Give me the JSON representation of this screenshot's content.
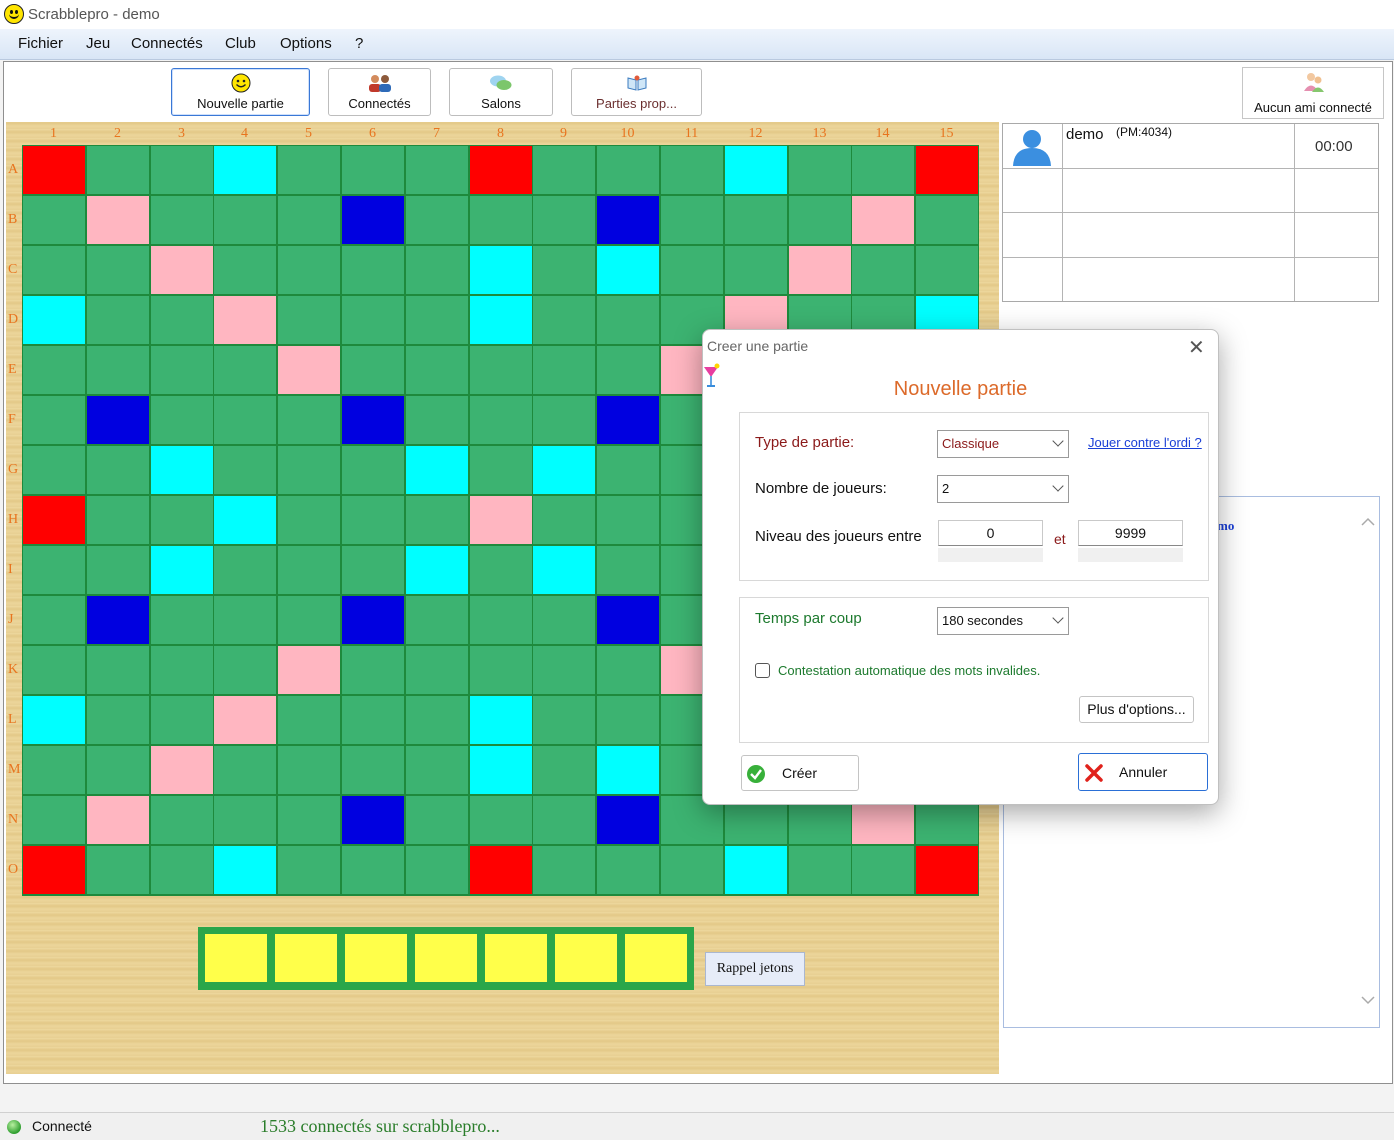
{
  "window": {
    "title": "Scrabblepro - demo"
  },
  "menu": [
    "Fichier",
    "Jeu",
    "Connectés",
    "Club",
    "Options",
    "?"
  ],
  "toolbar": {
    "new_game": "Nouvelle partie",
    "connected": "Connectés",
    "rooms": "Salons",
    "proposed": "Parties prop..."
  },
  "friends": {
    "label": "Aucun ami connecté"
  },
  "players": {
    "name": "demo",
    "pm": "(PM:4034)",
    "time": "00:00"
  },
  "board": {
    "columns": [
      "1",
      "2",
      "3",
      "4",
      "5",
      "6",
      "7",
      "8",
      "9",
      "10",
      "11",
      "12",
      "13",
      "14",
      "15"
    ],
    "rows": [
      "A",
      "B",
      "C",
      "D",
      "E",
      "F",
      "G",
      "H",
      "I",
      "J",
      "K",
      "L",
      "M",
      "N",
      "O"
    ],
    "colors": {
      "T": "#ff0000",
      "D": "#ffb6c1",
      "t": "#0000e0",
      "d": "#00ffff",
      "g": "#3cb371"
    },
    "layout": [
      "TggdgggTgggdggT",
      "gDgggtgggtgggDg",
      "ggDggggdgdggDgg",
      "dggDgggdgggDggd",
      "ggggDgggggDgggg",
      "gtgggtgggtgggtg",
      "ggdgggdgdgggdgg",
      "TggdgggDgggdggT",
      "ggdgggdgdgggdgg",
      "gtgggtgggtgggtg",
      "ggggDgggggDgggg",
      "dggDgggdgggDggd",
      "ggDggggdgdggDgg",
      "gDgggtgggtgggDg",
      "TggdgggTgggdggT"
    ]
  },
  "rack": {
    "button": "Rappel jetons"
  },
  "chat": {
    "visible_text": "mo"
  },
  "status": {
    "connected": "Connecté",
    "count": "1533 connectés sur scrabblepro..."
  },
  "dialog": {
    "title": "Creer une partie",
    "heading": "Nouvelle partie",
    "type_label": "Type de partie:",
    "type_value": "Classique",
    "vs_computer": "Jouer contre l'ordi ?",
    "players_label": "Nombre de joueurs:",
    "players_value": "2",
    "level_label": "Niveau des joueurs entre",
    "level_min": "0",
    "level_and": "et",
    "level_max": "9999",
    "time_label": "Temps par coup",
    "time_value": "180 secondes",
    "auto_challenge": "Contestation automatique des mots invalides.",
    "more_options": "Plus d'options...",
    "create": "Créer",
    "cancel": "Annuler"
  }
}
